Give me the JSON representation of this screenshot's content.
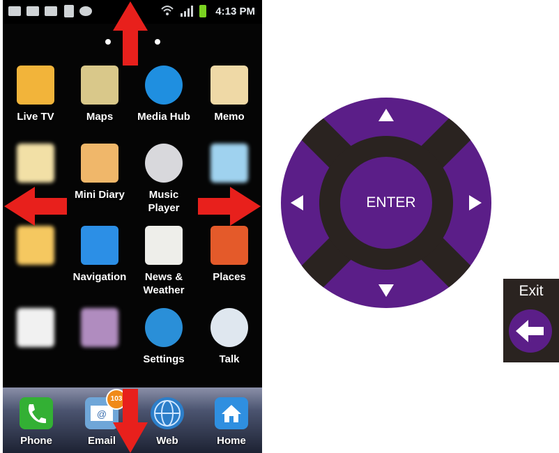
{
  "status_bar": {
    "time": "4:13 PM",
    "icons": [
      "mail-icon",
      "calendar-icon",
      "gmail-icon",
      "date-icon",
      "chat-icon",
      "wifi-icon",
      "signal-icon",
      "battery-icon"
    ]
  },
  "apps": [
    {
      "label": "Live TV",
      "icon": "tv-icon",
      "color": "#f2b43a"
    },
    {
      "label": "Maps",
      "icon": "maps-icon",
      "color": "#d9c88a"
    },
    {
      "label": "Media Hub",
      "icon": "media-hub-icon",
      "color": "#1f8fe0"
    },
    {
      "label": "Memo",
      "icon": "memo-icon",
      "color": "#efd9a6"
    },
    {
      "label": "",
      "icon": "messaging-icon",
      "color": "#f2e0a6"
    },
    {
      "label": "Mini Diary",
      "icon": "diary-icon",
      "color": "#f0b76a"
    },
    {
      "label": "Music Player",
      "icon": "music-icon",
      "color": "#d8d8dc"
    },
    {
      "label": "",
      "icon": "my-files-icon",
      "color": "#9fd2ef"
    },
    {
      "label": "",
      "icon": "blurred-app-icon",
      "color": "#f5c860"
    },
    {
      "label": "Navigation",
      "icon": "navigation-icon",
      "color": "#2c8fe6"
    },
    {
      "label": "News & Weather",
      "icon": "news-icon",
      "color": "#eeeeea"
    },
    {
      "label": "Places",
      "icon": "places-icon",
      "color": "#e45a2a"
    },
    {
      "label": "",
      "icon": "play-store-icon",
      "color": "#f1f1f1"
    },
    {
      "label": "",
      "icon": "blurred-app-icon",
      "color": "#b08cbf"
    },
    {
      "label": "Settings",
      "icon": "settings-icon",
      "color": "#2a8fd8"
    },
    {
      "label": "Talk",
      "icon": "talk-icon",
      "color": "#dfe7ef"
    }
  ],
  "dock": [
    {
      "label": "Phone",
      "icon": "phone-icon",
      "color": "#33b034"
    },
    {
      "label": "Email",
      "icon": "email-icon",
      "color": "#6fa6d8",
      "badge": "103"
    },
    {
      "label": "Web",
      "icon": "globe-icon",
      "color": "#2c7ec9"
    },
    {
      "label": "Home",
      "icon": "home-icon",
      "color": "#2f8fe0"
    }
  ],
  "dpad": {
    "enter_label": "ENTER",
    "color_purple": "#5b1e88",
    "color_dark": "#2a2320"
  },
  "exit": {
    "label": "Exit"
  },
  "colors": {
    "arrow_red": "#e8201c"
  }
}
